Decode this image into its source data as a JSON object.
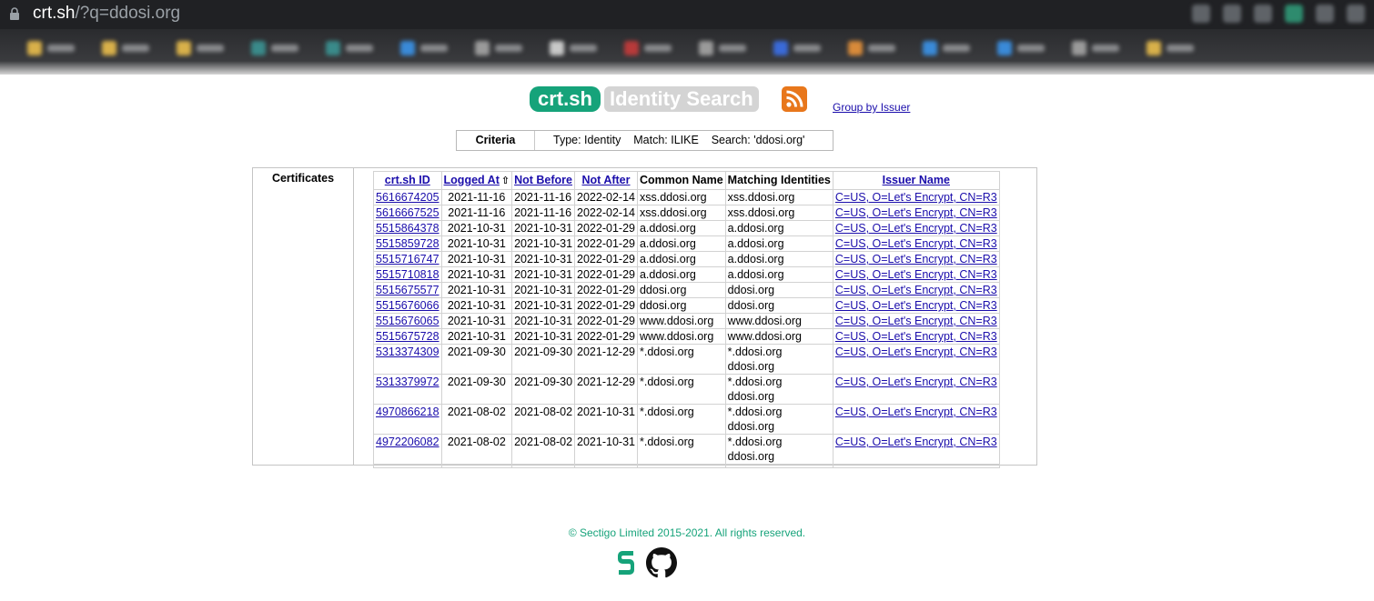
{
  "browser": {
    "url_host": "crt.sh",
    "url_path": "/?q=ddosi.org"
  },
  "header": {
    "logo_text": "crt.sh",
    "subtitle": "Identity Search",
    "group_link": "Group by Issuer"
  },
  "criteria": {
    "label": "Criteria",
    "value": "Type: Identity    Match: ILIKE    Search: 'ddosi.org'"
  },
  "certificates": {
    "section_label": "Certificates",
    "columns": [
      {
        "label": "crt.sh ID",
        "link": true
      },
      {
        "label": "Logged At",
        "link": true,
        "sort": "⇧"
      },
      {
        "label": "Not Before",
        "link": true
      },
      {
        "label": "Not After",
        "link": true
      },
      {
        "label": "Common Name",
        "link": false
      },
      {
        "label": "Matching Identities",
        "link": false
      },
      {
        "label": "Issuer Name",
        "link": true
      }
    ],
    "rows": [
      {
        "id": "5616674205",
        "logged": "2021-11-16",
        "not_before": "2021-11-16",
        "not_after": "2022-02-14",
        "cn": "xss.ddosi.org",
        "identities": [
          "xss.ddosi.org"
        ],
        "issuer": "C=US, O=Let's Encrypt, CN=R3"
      },
      {
        "id": "5616667525",
        "logged": "2021-11-16",
        "not_before": "2021-11-16",
        "not_after": "2022-02-14",
        "cn": "xss.ddosi.org",
        "identities": [
          "xss.ddosi.org"
        ],
        "issuer": "C=US, O=Let's Encrypt, CN=R3"
      },
      {
        "id": "5515864378",
        "logged": "2021-10-31",
        "not_before": "2021-10-31",
        "not_after": "2022-01-29",
        "cn": "a.ddosi.org",
        "identities": [
          "a.ddosi.org"
        ],
        "issuer": "C=US, O=Let's Encrypt, CN=R3"
      },
      {
        "id": "5515859728",
        "logged": "2021-10-31",
        "not_before": "2021-10-31",
        "not_after": "2022-01-29",
        "cn": "a.ddosi.org",
        "identities": [
          "a.ddosi.org"
        ],
        "issuer": "C=US, O=Let's Encrypt, CN=R3"
      },
      {
        "id": "5515716747",
        "logged": "2021-10-31",
        "not_before": "2021-10-31",
        "not_after": "2022-01-29",
        "cn": "a.ddosi.org",
        "identities": [
          "a.ddosi.org"
        ],
        "issuer": "C=US, O=Let's Encrypt, CN=R3"
      },
      {
        "id": "5515710818",
        "logged": "2021-10-31",
        "not_before": "2021-10-31",
        "not_after": "2022-01-29",
        "cn": "a.ddosi.org",
        "identities": [
          "a.ddosi.org"
        ],
        "issuer": "C=US, O=Let's Encrypt, CN=R3"
      },
      {
        "id": "5515675577",
        "logged": "2021-10-31",
        "not_before": "2021-10-31",
        "not_after": "2022-01-29",
        "cn": "ddosi.org",
        "identities": [
          "ddosi.org"
        ],
        "issuer": "C=US, O=Let's Encrypt, CN=R3"
      },
      {
        "id": "5515676066",
        "logged": "2021-10-31",
        "not_before": "2021-10-31",
        "not_after": "2022-01-29",
        "cn": "ddosi.org",
        "identities": [
          "ddosi.org"
        ],
        "issuer": "C=US, O=Let's Encrypt, CN=R3"
      },
      {
        "id": "5515676065",
        "logged": "2021-10-31",
        "not_before": "2021-10-31",
        "not_after": "2022-01-29",
        "cn": "www.ddosi.org",
        "identities": [
          "www.ddosi.org"
        ],
        "issuer": "C=US, O=Let's Encrypt, CN=R3"
      },
      {
        "id": "5515675728",
        "logged": "2021-10-31",
        "not_before": "2021-10-31",
        "not_after": "2022-01-29",
        "cn": "www.ddosi.org",
        "identities": [
          "www.ddosi.org"
        ],
        "issuer": "C=US, O=Let's Encrypt, CN=R3"
      },
      {
        "id": "5313374309",
        "logged": "2021-09-30",
        "not_before": "2021-09-30",
        "not_after": "2021-12-29",
        "cn": "*.ddosi.org",
        "identities": [
          "*.ddosi.org",
          "ddosi.org"
        ],
        "issuer": "C=US, O=Let's Encrypt, CN=R3"
      },
      {
        "id": "5313379972",
        "logged": "2021-09-30",
        "not_before": "2021-09-30",
        "not_after": "2021-12-29",
        "cn": "*.ddosi.org",
        "identities": [
          "*.ddosi.org",
          "ddosi.org"
        ],
        "issuer": "C=US, O=Let's Encrypt, CN=R3"
      },
      {
        "id": "4970866218",
        "logged": "2021-08-02",
        "not_before": "2021-08-02",
        "not_after": "2021-10-31",
        "cn": "*.ddosi.org",
        "identities": [
          "*.ddosi.org",
          "ddosi.org"
        ],
        "issuer": "C=US, O=Let's Encrypt, CN=R3"
      },
      {
        "id": "4972206082",
        "logged": "2021-08-02",
        "not_before": "2021-08-02",
        "not_after": "2021-10-31",
        "cn": "*.ddosi.org",
        "identities": [
          "*.ddosi.org",
          "ddosi.org"
        ],
        "issuer": "C=US, O=Let's Encrypt, CN=R3"
      }
    ]
  },
  "footer": {
    "copyright": "© Sectigo Limited 2015-2021. All rights reserved."
  },
  "colors": {
    "brand_green": "#16a37a",
    "link_blue": "#1a0dab",
    "rss_orange": "#e36b12"
  }
}
